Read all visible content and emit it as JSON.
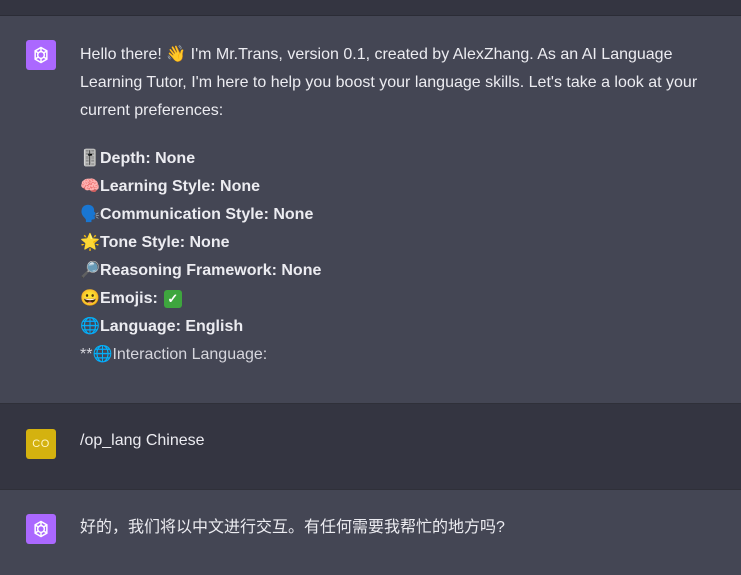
{
  "conversation": {
    "bot_message_1": {
      "intro": "Hello there! 👋 I'm Mr.Trans, version 0.1, created by AlexZhang. As an AI Language Learning Tutor, I'm here to help you boost your language skills. Let's take a look at your current preferences:",
      "preferences": [
        {
          "icon": "🎚️",
          "icon_name": "slider-icon",
          "text": "Depth: None"
        },
        {
          "icon": "🧠",
          "icon_name": "brain-icon",
          "text": "Learning Style: None"
        },
        {
          "icon": "🗣️",
          "icon_name": "speaking-head-icon",
          "text": "Communication Style: None"
        },
        {
          "icon": "🌟",
          "icon_name": "star-icon",
          "text": "Tone Style: None"
        },
        {
          "icon": "🔎",
          "icon_name": "magnifier-icon",
          "text": "Reasoning Framework: None"
        },
        {
          "icon": "😀",
          "icon_name": "smile-icon",
          "text": "Emojis:",
          "check": "✓"
        },
        {
          "icon": "🌐",
          "icon_name": "globe-icon",
          "text": "Language: English"
        }
      ],
      "interaction_prefix": "**",
      "interaction_icon": "🌐",
      "interaction_text": "Interaction Language:"
    },
    "user_message": {
      "avatar_initials": "CO",
      "text": "/op_lang Chinese"
    },
    "bot_message_2": {
      "text": "好的，我们将以中文进行交互。有任何需要我帮忙的地方吗?"
    }
  },
  "colors": {
    "assistant_bg": "#444654",
    "user_bg": "#343541",
    "bot_avatar": "#ab68ff",
    "user_avatar": "#d4b20f",
    "text": "#ececf1"
  }
}
